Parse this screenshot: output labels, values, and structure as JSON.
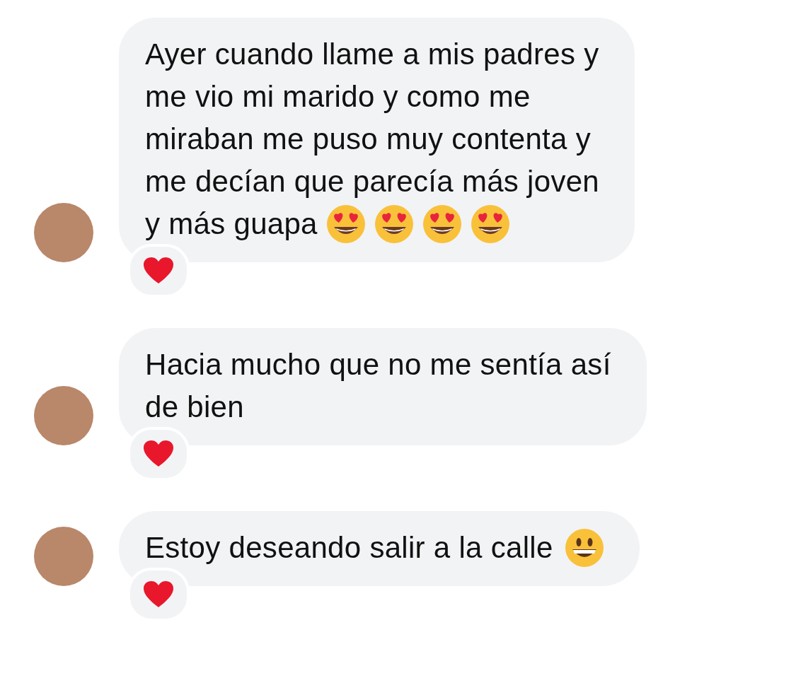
{
  "messages": [
    {
      "lines": [
        "Ayer cuando llame a mis padres y",
        "me vio mi marido y como me",
        "miraban me puso muy contenta y",
        "me decían que parecía más joven",
        "y más guapa"
      ],
      "emoji": [
        {
          "kind": "heart-eyes"
        },
        {
          "kind": "heart-eyes"
        },
        {
          "kind": "heart-eyes"
        },
        {
          "kind": "heart-eyes"
        }
      ],
      "reaction": {
        "kind": "heart"
      }
    },
    {
      "lines": [
        "Hacia mucho que no me sentía así",
        "de bien"
      ],
      "reaction": {
        "kind": "heart"
      }
    },
    {
      "lines": [
        "Estoy deseando salir a la calle"
      ],
      "emoji": [
        {
          "kind": "grin"
        }
      ],
      "reaction": {
        "kind": "heart"
      }
    }
  ]
}
